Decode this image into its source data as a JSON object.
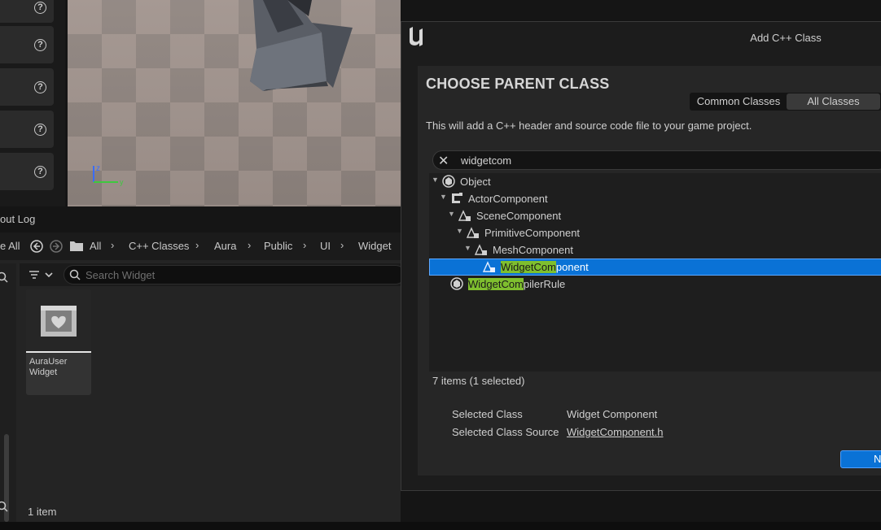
{
  "output_log_tab": {
    "label": "out Log"
  },
  "content_browser": {
    "toolbar": {
      "save_all_label": "e All",
      "breadcrumbs": [
        "All",
        "C++ Classes",
        "Aura",
        "Public",
        "UI",
        "Widget"
      ]
    },
    "search": {
      "placeholder": "Search Widget"
    },
    "assets": [
      {
        "label": "AuraUser Widget"
      }
    ],
    "item_count": "1 item"
  },
  "dialog": {
    "title": "Add C++ Class",
    "heading": "CHOOSE PARENT CLASS",
    "tabs": {
      "common": "Common Classes",
      "all": "All Classes",
      "active": "all"
    },
    "description": "This will add a C++ header and source code file to your game project.",
    "search_value": "widgetcom",
    "tree": [
      {
        "label": "Object",
        "icon": "object-icon"
      },
      {
        "label": "ActorComponent",
        "icon": "actor-component-icon"
      },
      {
        "label": "SceneComponent",
        "icon": "scene-component-icon"
      },
      {
        "label": "PrimitiveComponent",
        "icon": "primitive-component-icon"
      },
      {
        "label": "MeshComponent",
        "icon": "mesh-component-icon"
      },
      {
        "label": "WidgetComponent",
        "match": "WidgetCom",
        "rest": "ponent",
        "icon": "widget-component-icon",
        "selected": true
      },
      {
        "label": "WidgetCompilerRule",
        "match": "WidgetCom",
        "rest": "pilerRule",
        "icon": "object-icon"
      }
    ],
    "items_count": "7 items (1 selected)",
    "selected_class_label": "Selected Class",
    "selected_class_value": "Widget Component",
    "selected_source_label": "Selected Class Source",
    "selected_source_value": "WidgetComponent.h",
    "next_label": "Next",
    "accent_color": "#0a72d6",
    "highlight_color": "#7fbf2e"
  }
}
